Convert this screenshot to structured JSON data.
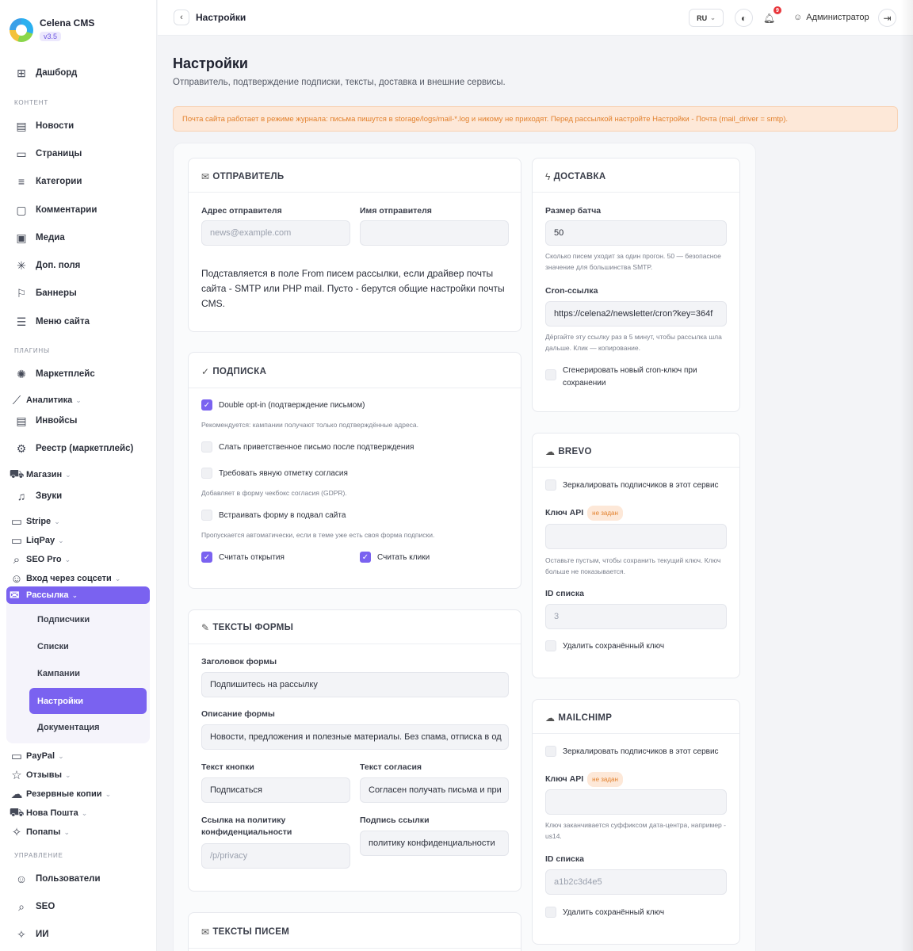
{
  "brand": {
    "name": "Celena CMS",
    "version": "v3.5"
  },
  "sidebar": {
    "dashboard": "Дашборд",
    "section_content": "КОНТЕНТ",
    "content": [
      "Новости",
      "Страницы",
      "Категории",
      "Комментарии",
      "Медиа",
      "Доп. поля",
      "Баннеры",
      "Меню сайта"
    ],
    "section_plugins": "ПЛАГИНЫ",
    "marketplace": "Маркетплейс",
    "analytics": "Аналитика",
    "invoices": "Инвойсы",
    "registry": "Реестр (маркетплейс)",
    "shop": "Магазин",
    "sounds": "Звуки",
    "stripe": "Stripe",
    "liqpay": "LiqPay",
    "seo_pro": "SEO Pro",
    "social_login": "Вход через соцсети",
    "newsletter": "Рассылка",
    "newsletter_sub": [
      "Подписчики",
      "Списки",
      "Кампании",
      "Настройки",
      "Документация"
    ],
    "paypal": "PayPal",
    "reviews": "Отзывы",
    "backups": "Резервные копии",
    "nova_poshta": "Нова Пошта",
    "popups": "Попапы",
    "section_manage": "УПРАВЛЕНИЕ",
    "users": "Пользователи",
    "seo": "SEO",
    "ai": "ИИ"
  },
  "topbar": {
    "breadcrumb": "Настройки",
    "lang": "RU",
    "notifications": "9",
    "user": "Администратор"
  },
  "page": {
    "title": "Настройки",
    "subtitle": "Отправитель, подтверждение подписки, тексты, доставка и внешние сервисы.",
    "alert": "Почта сайта работает в режиме журнала: письма пишутся в storage/logs/mail-*.log и никому не приходят. Перед рассылкой настройте Настройки - Почта (mail_driver = smtp)."
  },
  "sender": {
    "title": "ОТПРАВИТЕЛЬ",
    "address_label": "Адрес отправителя",
    "address_placeholder": "news@example.com",
    "name_label": "Имя отправителя",
    "name_value": "",
    "description": "Подставляется в поле From писем рассылки, если драйвер почты сайта - SMTP или PHP mail. Пусто - берутся общие настройки почты CMS."
  },
  "subscription": {
    "title": "ПОДПИСКА",
    "double_optin": "Double opt-in (подтверждение письмом)",
    "double_optin_help": "Рекомендуется: кампании получают только подтверждённые адреса.",
    "welcome": "Слать приветственное письмо после подтверждения",
    "consent": "Требовать явную отметку согласия",
    "consent_help": "Добавляет в форму чекбокс согласия (GDPR).",
    "footer_form": "Встраивать форму в подвал сайта",
    "footer_form_help": "Пропускается автоматически, если в теме уже есть своя форма подписки.",
    "track_opens": "Считать открытия",
    "track_clicks": "Считать клики"
  },
  "form_texts": {
    "title": "ТЕКСТЫ ФОРМЫ",
    "heading_label": "Заголовок формы",
    "heading_value": "Подпишитесь на рассылку",
    "desc_label": "Описание формы",
    "desc_value": "Новости, предложения и полезные материалы. Без спама, отписка в од",
    "button_label": "Текст кнопки",
    "button_value": "Подписаться",
    "consent_label": "Текст согласия",
    "consent_value": "Согласен получать письма и при",
    "policy_label": "Ссылка на политику конфиденциальности",
    "policy_placeholder": "/p/privacy",
    "link_label": "Подпись ссылки",
    "link_value": "политику конфиденциальности"
  },
  "email_texts": {
    "title": "ТЕКСТЫ ПИСЕМ"
  },
  "delivery": {
    "title": "ДОСТАВКА",
    "batch_label": "Размер батча",
    "batch_value": "50",
    "batch_help": "Сколько писем уходит за один прогон. 50 — безопасное значение для большинства SMTP.",
    "cron_label": "Cron-ссылка",
    "cron_value": "https://celena2/newsletter/cron?key=364f",
    "cron_help": "Дёргайте эту ссылку раз в 5 минут, чтобы рассылка шла дальше. Клик — копирование.",
    "regen": "Сгенерировать новый cron-ключ при сохранении"
  },
  "brevo": {
    "title": "BREVO",
    "mirror": "Зеркалировать подписчиков в этот сервис",
    "api_label": "Ключ API",
    "api_badge": "не задан",
    "api_help": "Оставьте пустым, чтобы сохранить текущий ключ. Ключ больше не показывается.",
    "list_label": "ID списка",
    "list_placeholder": "3",
    "delete": "Удалить сохранённый ключ"
  },
  "mailchimp": {
    "title": "MAILCHIMP",
    "mirror": "Зеркалировать подписчиков в этот сервис",
    "api_label": "Ключ API",
    "api_badge": "не задан",
    "api_help": "Ключ заканчивается суффиксом дата-центра, например -us14.",
    "list_label": "ID списка",
    "list_placeholder": "a1b2c3d4e5",
    "delete": "Удалить сохранённый ключ"
  }
}
